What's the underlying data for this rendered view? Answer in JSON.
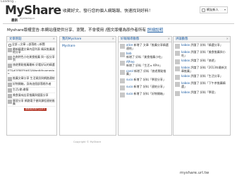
{
  "header": {
    "loading": "Loading...",
    "logo_part1": "My",
    "logo_part2": "Share",
    "logo_sub": "mysharing.cc",
    "tagline": "收藏好文、發行您的個人網路報、快速找到好料！",
    "user_name": "網友新人"
  },
  "nav": {
    "label": "最新"
  },
  "notice": {
    "text": "Myshare版權宣告:本網站僅提供分享、瀏覽，不會使用 /圖文版權為原作者所有",
    "link": "詳細說明"
  },
  "columns": {
    "c1": {
      "title": "文章熱點",
      "controls": "全部 ◇文章 ◇部落格 ◇新聞",
      "items": [
        {
          "text": "最新精選文章內容列表 精采推薦連結分享"
        },
        {
          "text": "台南特色小吃美食推薦 與一起分享到"
        },
        {
          "text": "旅遊景點推薦最新 好看好玩的精選"
        },
        {
          "text": "ET&#3F8EF9#E3/Wardtifrcamedou",
          "noimg": true
        },
        {
          "text": "推薦文章分享 生活資訊與網路連結"
        },
        {
          "text": "好物開箱，身為這個部落格作者"
        },
        {
          "text": "生活(書)書籤"
        },
        {
          "text": "美食風味店家推薦與優惠分享"
        },
        {
          "text": "學習分享 網路電子書與課程連結推薦"
        }
      ],
      "bar": "觀看更多熱門文章 ▸"
    },
    "c2": {
      "title": "我的Myshare",
      "body": "Myshare"
    },
    "c3": {
      "title": "好報報導動態",
      "items": [
        {
          "user": "alice",
          "text": "新增了 文章「推薦分享精選連結」"
        },
        {
          "user": "bob",
          "text": "新增了 好料「美食推薦小吃」"
        },
        {
          "user": "APreo",
          "text": "新增了 好料「生活 ▸ APre」"
        },
        {
          "user": "carol",
          "text": "新增了 好料「旅遊景點推薦」"
        },
        {
          "user": "suco",
          "text": "新增了 好料「學習分享」"
        },
        {
          "user": "suco",
          "text": "新增了 好料「連結分享」"
        },
        {
          "user": "suco",
          "text": "新增了 好料「好物開箱」"
        }
      ]
    },
    "c4": {
      "title": "評論動態",
      "items": [
        {
          "user": "kaboo",
          "text": "評論了 好料「精選分享」"
        },
        {
          "user": "kaboo",
          "text": "評論了 好料「美食推薦與小吃」"
        },
        {
          "user": "kaboo",
          "text": "評論了 好料「旅遊」"
        },
        {
          "user": "kaboo",
          "text": "評論了 好料「2013年最新文章推薦」"
        },
        {
          "user": "kaboo",
          "text": "評論了 好料「生活分享」"
        },
        {
          "user": "kaboo",
          "text": "評論了 好料「下午茶推薦精選」"
        },
        {
          "user": "kaboo",
          "text": "評論了 好料「學習」"
        }
      ]
    }
  },
  "footer": {
    "text": "Copyright © MyShare"
  },
  "watermark": "myshare.url.tw",
  "colors": {
    "link": "#1a5aa0",
    "accent_bar": "#b53a2a"
  }
}
